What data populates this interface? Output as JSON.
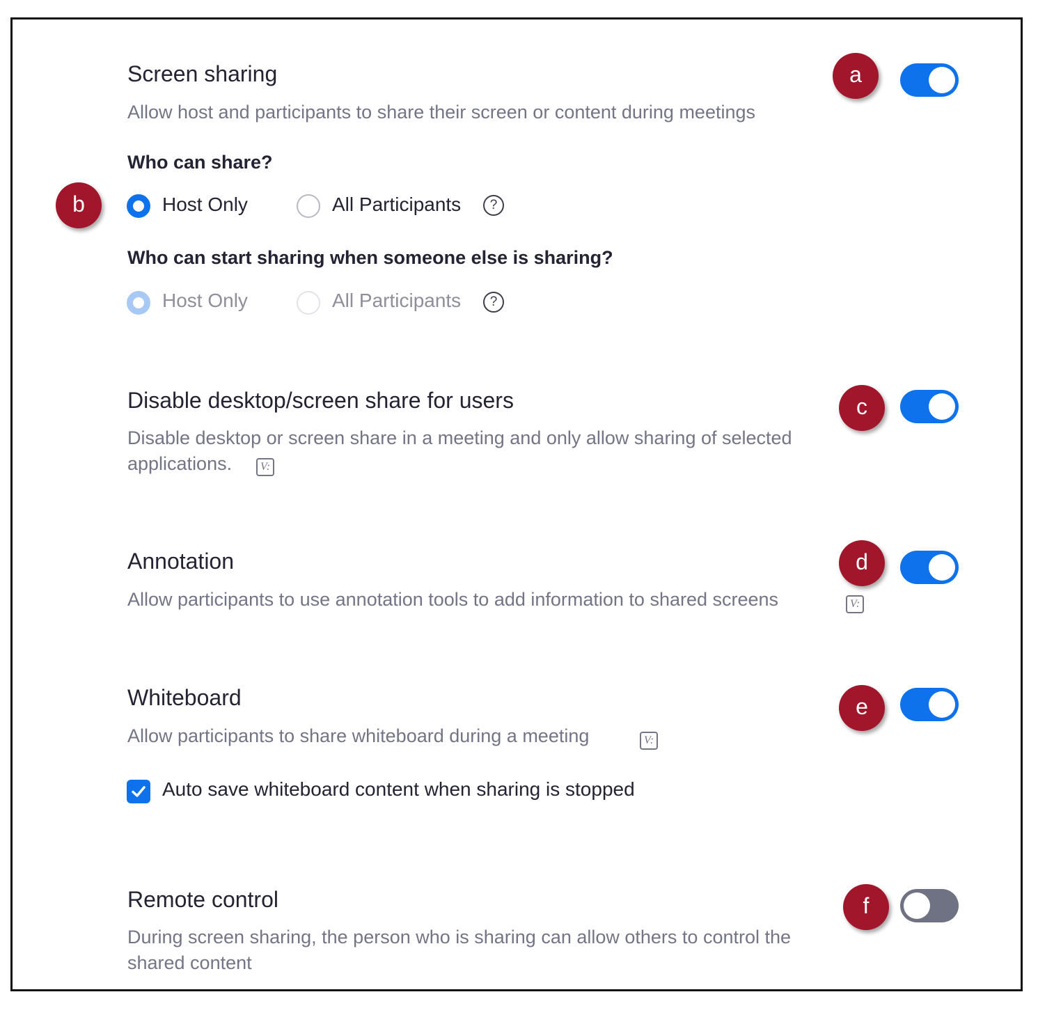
{
  "colors": {
    "accent_blue": "#0e72ed",
    "toggle_off": "#6e7283",
    "badge_red": "#a1162b",
    "title_text": "#232333",
    "desc_text": "#747487"
  },
  "settings": {
    "screen_sharing": {
      "badge": "a",
      "title": "Screen sharing",
      "description": "Allow host and participants to share their screen or content during meetings",
      "enabled": true,
      "who_can_share": {
        "badge": "b",
        "label": "Who can share?",
        "options": [
          "Host Only",
          "All Participants"
        ],
        "selected": "Host Only",
        "help_icon": "?"
      },
      "who_can_start": {
        "label": "Who can start sharing when someone else is sharing?",
        "options": [
          "Host Only",
          "All Participants"
        ],
        "selected": "Host Only",
        "disabled": true,
        "help_icon": "?"
      }
    },
    "disable_desktop": {
      "badge": "c",
      "title": "Disable desktop/screen share for users",
      "description_line1": "Disable desktop or screen share in a meeting and only allow sharing of selected",
      "description_line2": "applications.",
      "enabled": true,
      "icon": "v-icon"
    },
    "annotation": {
      "badge": "d",
      "title": "Annotation",
      "description": "Allow participants to use annotation tools to add information to shared screens",
      "enabled": true,
      "icon": "v-icon"
    },
    "whiteboard": {
      "badge": "e",
      "title": "Whiteboard",
      "description": "Allow participants to share whiteboard during a meeting",
      "enabled": true,
      "icon": "v-icon",
      "auto_save": {
        "label": "Auto save whiteboard content when sharing is stopped",
        "checked": true
      }
    },
    "remote_control": {
      "badge": "f",
      "title": "Remote control",
      "description_line1": "During screen sharing, the person who is sharing can allow others to control the",
      "description_line2": "shared content",
      "enabled": false
    }
  },
  "glyphs": {
    "help": "?",
    "v_icon": "V:"
  }
}
